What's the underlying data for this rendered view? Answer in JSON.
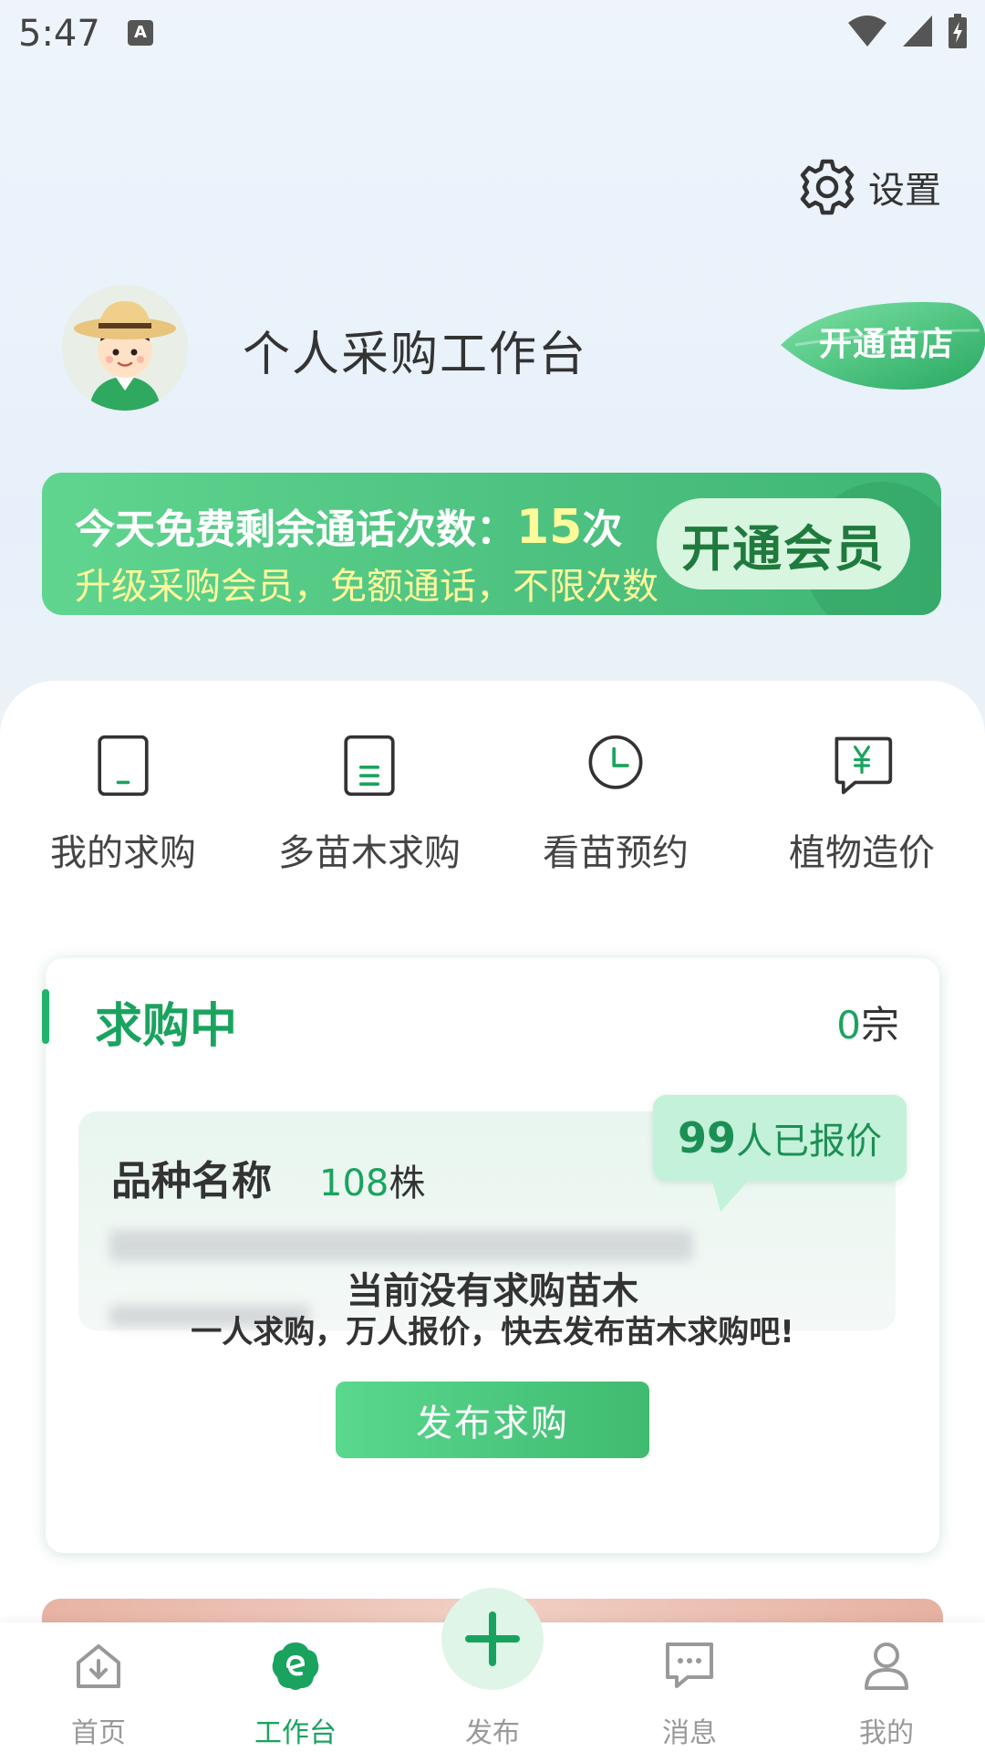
{
  "status_bar": {
    "time": "5:47",
    "a_badge": "A"
  },
  "header": {
    "settings_label": "设置",
    "title": "个人采购工作台",
    "open_shop_label": "开通苗店"
  },
  "member_banner": {
    "line1_prefix": "今天免费剩余通话次数：",
    "line1_count": "15",
    "line1_suffix": "次",
    "line2": "升级采购会员，免额通话，不限次数",
    "button_label": "开通会员"
  },
  "quick_actions": [
    {
      "label": "我的求购",
      "icon": "tablet-icon"
    },
    {
      "label": "多苗木求购",
      "icon": "document-icon"
    },
    {
      "label": "看苗预约",
      "icon": "clock-icon"
    },
    {
      "label": "植物造价",
      "icon": "yen-message-icon"
    }
  ],
  "purchasing": {
    "title": "求购中",
    "count": "0",
    "count_unit": "宗",
    "sample_name": "品种名称",
    "sample_qty": "108",
    "sample_unit": "株",
    "quote_count": "99",
    "quote_suffix": "人已报价",
    "empty_title": "当前没有求购苗木",
    "empty_subtitle": "一人求购，万人报价，快去发布苗木求购吧!",
    "publish_label": "发布求购"
  },
  "tabs": [
    {
      "label": "首页",
      "icon": "home-icon"
    },
    {
      "label": "工作台",
      "icon": "workbench-icon",
      "active": true
    },
    {
      "label": "发布",
      "icon": "plus-icon"
    },
    {
      "label": "消息",
      "icon": "message-icon"
    },
    {
      "label": "我的",
      "icon": "user-icon"
    }
  ],
  "colors": {
    "accent": "#1aa35f",
    "banner_green": "#4cc07f",
    "highlight_yellow": "#fffb9a"
  }
}
